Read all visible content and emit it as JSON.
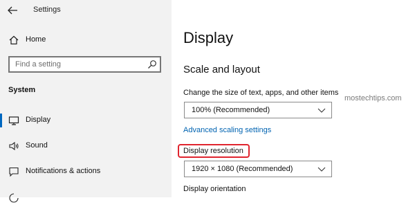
{
  "window": {
    "title": "Settings"
  },
  "sidebar": {
    "home_label": "Home",
    "search": {
      "placeholder": "Find a setting"
    },
    "section_heading": "System",
    "items": [
      {
        "label": "Display",
        "icon": "monitor-icon",
        "active": true
      },
      {
        "label": "Sound",
        "icon": "speaker-icon",
        "active": false
      },
      {
        "label": "Notifications & actions",
        "icon": "notification-icon",
        "active": false
      }
    ]
  },
  "main": {
    "page_title": "Display",
    "section_title": "Scale and layout",
    "scale": {
      "label": "Change the size of text, apps, and other items",
      "value": "100% (Recommended)"
    },
    "advanced_link": "Advanced scaling settings",
    "resolution": {
      "label": "Display resolution",
      "value": "1920 × 1080 (Recommended)"
    },
    "orientation_label": "Display orientation"
  },
  "watermark": "mostechtips.com",
  "colors": {
    "accent": "#0067c0",
    "link": "#0063b1",
    "highlight": "#e0242e",
    "sidebar_bg": "#f2f2f2"
  }
}
